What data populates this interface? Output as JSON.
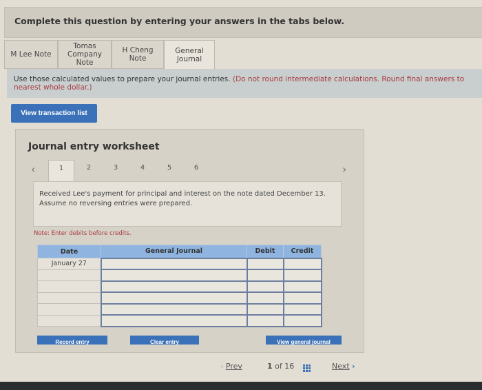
{
  "banner": {
    "text": "Complete this question by entering your answers in the tabs below."
  },
  "tabs": [
    {
      "label": "M Lee Note",
      "active": false
    },
    {
      "label": "Tomas Company Note",
      "active": false
    },
    {
      "label": "H Cheng Note",
      "active": false
    },
    {
      "label": "General Journal",
      "active": true
    }
  ],
  "instruction": {
    "text": "Use those calculated values to prepare your journal entries.",
    "note": "(Do not round intermediate calculations. Round final answers to nearest whole dollar.)"
  },
  "view_transaction_list": "View transaction list",
  "worksheet": {
    "title": "Journal entry worksheet",
    "prev_icon": "chevron-left-icon",
    "next_icon": "chevron-right-icon",
    "steps": [
      "1",
      "2",
      "3",
      "4",
      "5",
      "6"
    ],
    "active_step": "1",
    "description": "Received Lee's payment for principal and interest on the note dated December 13. Assume no reversing entries were prepared.",
    "note": "Note: Enter debits before credits.",
    "table": {
      "headers": [
        "Date",
        "General Journal",
        "Debit",
        "Credit"
      ],
      "rows": [
        {
          "date": "January 27",
          "account": "",
          "debit": "",
          "credit": ""
        },
        {
          "date": "",
          "account": "",
          "debit": "",
          "credit": ""
        },
        {
          "date": "",
          "account": "",
          "debit": "",
          "credit": ""
        },
        {
          "date": "",
          "account": "",
          "debit": "",
          "credit": ""
        },
        {
          "date": "",
          "account": "",
          "debit": "",
          "credit": ""
        },
        {
          "date": "",
          "account": "",
          "debit": "",
          "credit": ""
        }
      ]
    },
    "buttons": {
      "record": "Record entry",
      "clear": "Clear entry",
      "view_general": "View general journal"
    }
  },
  "pager": {
    "prev": "Prev",
    "current": "1",
    "of_label": "of",
    "total": "16",
    "next": "Next"
  }
}
